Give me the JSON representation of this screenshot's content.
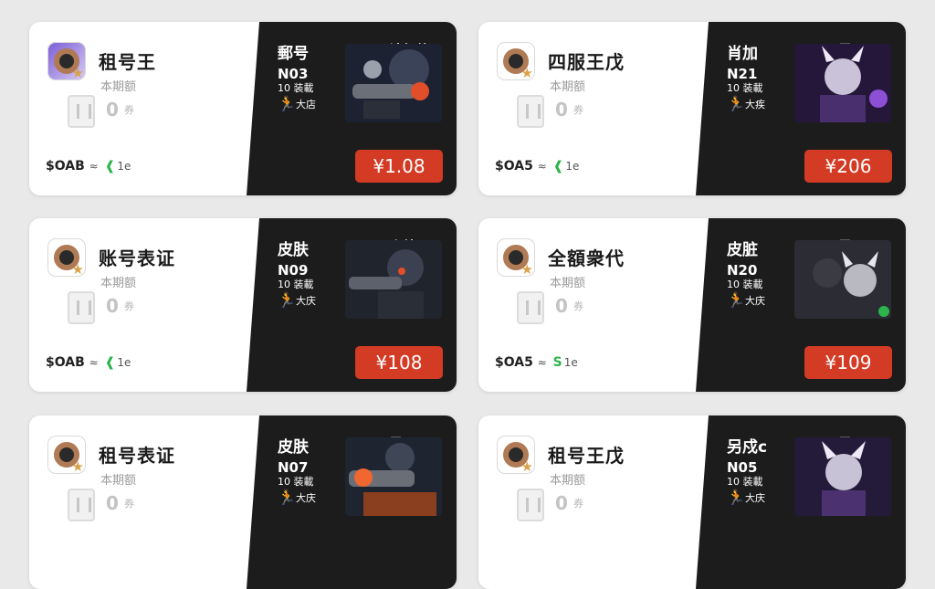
{
  "colors": {
    "page_background": "#e9e9ea",
    "card_light": "#ffffff",
    "card_dark": "#1c1c1c",
    "price_button": "#d33b24",
    "accent_green": "#2bb44a"
  },
  "cards": [
    {
      "logo_icon": "purple-ring-logo",
      "app_name": "租号王",
      "sub_name": "本期额",
      "count": "0",
      "count_unit": "券",
      "price_code": "$OAB",
      "price_code_tail": "1e",
      "label_left": "郵号",
      "label_right": "计细纹",
      "stat_line1": "N03",
      "stat_line2": "10 装載",
      "stat_line3": "大店",
      "art_icon": "armored-gunner-art",
      "price": "¥1.08"
    },
    {
      "logo_icon": "ring-logo",
      "app_name": "四服王戊",
      "sub_name": "本期额",
      "count": "0",
      "count_unit": "券",
      "price_code": "$OA5",
      "price_code_tail": "1e",
      "label_left": "肖加",
      "label_right": "另 Stc",
      "stat_line1": "N21",
      "stat_line2": "10 装載",
      "stat_line3": "大疾",
      "art_icon": "horned-warrior-art",
      "price": "¥206"
    },
    {
      "logo_icon": "ring-logo",
      "app_name": "账号表证",
      "sub_name": "本期额",
      "count": "0",
      "count_unit": "券",
      "price_code": "$OAB",
      "price_code_tail": "1e",
      "label_left": "皮肤",
      "label_right": "介绩Ic",
      "stat_line1": "N09",
      "stat_line2": "10 装載",
      "stat_line3": "大庆",
      "art_icon": "armored-gunner-art",
      "price": "¥108"
    },
    {
      "logo_icon": "ring-logo",
      "app_name": "全額衆代",
      "sub_name": "本期额",
      "count": "0",
      "count_unit": "券",
      "price_code": "$OA5",
      "price_code_tail": "1e",
      "label_left": "皮脏",
      "label_right": "另 Kic",
      "stat_line1": "N20",
      "stat_line2": "10 装載",
      "stat_line3": "大庆",
      "art_icon": "horned-warrior-art",
      "price": "¥109"
    },
    {
      "logo_icon": "ring-logo",
      "app_name": "租号表证",
      "sub_name": "本期额",
      "count": "0",
      "count_unit": "券",
      "price_code": "",
      "price_code_tail": "",
      "label_left": "皮肤",
      "label_right": "另 Stc",
      "stat_line1": "N07",
      "stat_line2": "10 装載",
      "stat_line3": "大庆",
      "art_icon": "armored-gunner-art",
      "price": ""
    },
    {
      "logo_icon": "ring-logo",
      "app_name": "租号王戊",
      "sub_name": "本期额",
      "count": "0",
      "count_unit": "券",
      "price_code": "",
      "price_code_tail": "",
      "label_left": "另戍c",
      "label_right": "另 Stc",
      "stat_line1": "N05",
      "stat_line2": "10 装載",
      "stat_line3": "大庆",
      "art_icon": "horned-warrior-art",
      "price": ""
    }
  ]
}
